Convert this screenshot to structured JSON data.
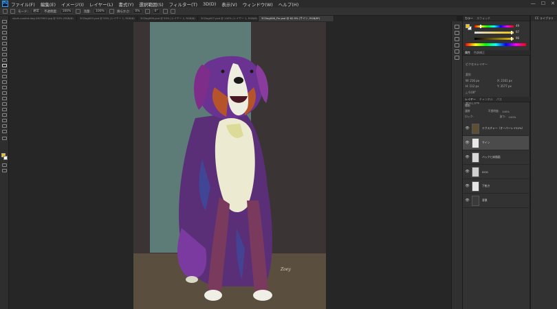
{
  "app": {
    "logo_text": "Ps"
  },
  "menu": [
    "ファイル(F)",
    "編集(E)",
    "イメージ(I)",
    "レイヤー(L)",
    "書式(Y)",
    "選択範囲(S)",
    "フィルター(T)",
    "3D(D)",
    "表示(V)",
    "ウィンドウ(W)",
    "ヘルプ(H)"
  ],
  "window_controls": [
    "—",
    "☐",
    "✕"
  ],
  "options_bar": {
    "mode_label": "モード:",
    "mode_value": "通常",
    "opacity_label": "不透明度:",
    "opacity_value": "100%",
    "flow_label": "流量:",
    "flow_value": "100%",
    "smoothing_label": "滑らかさ:",
    "smoothing_value": "0%",
    "angle_value": "0°"
  },
  "tabs": [
    {
      "label": "short-coated-dog-2623902.jpg @ 50% (RGB/8)",
      "active": false
    },
    {
      "label": "3CDog003.psd @ 50% (レイヤー 1, RGB/8)",
      "active": false
    },
    {
      "label": "3CDog006.psd @ 50% (レイヤー 2, RGB/8)",
      "active": false
    },
    {
      "label": "3CDog007.psd @ 100% (レイヤー 1, RGB/8)",
      "active": false
    },
    {
      "label": "3CDog008_Fin.psd @ 62.9% (サイン, RGB/8*)",
      "active": true
    }
  ],
  "color_panel": {
    "tabs": [
      "カラー",
      "スウォッチ"
    ],
    "h_value": "49",
    "s_value": "97",
    "b_value": "96",
    "fg_color": "#f1c40f",
    "bg_color": "#ffffff",
    "h_fill": 0.14,
    "s_fill": 0.97,
    "b_fill": 0.96
  },
  "properties_panel": {
    "tabs": [
      "属性",
      "色調補正"
    ],
    "kind": "ピクセルレイヤー",
    "section": "変形",
    "w": "W: 216 px",
    "x": "X: 2161 px",
    "h": "H: 112 px",
    "y": "Y: 3577 px",
    "angle": "△ 0.00°",
    "align_label": "整列と分布"
  },
  "layers_panel": {
    "tabs": [
      "レイヤー",
      "チャンネル",
      "パス"
    ],
    "filter_label": "種類",
    "blend_mode": "通常",
    "opacity_label": "不透明度:",
    "opacity_value": "100%",
    "lock_label": "ロック:",
    "fill_label": "塗り:",
    "fill_value": "100%",
    "layers": [
      {
        "name": "テクスチャー（オーバーレイ52%）",
        "selected": false,
        "thumb": "#5e4e33"
      },
      {
        "name": "サイン",
        "selected": true,
        "thumb": "#e8e8e8"
      },
      {
        "name": "バックと床描画",
        "selected": false,
        "thumb": "#d9d9d9"
      },
      {
        "name": "DOG",
        "selected": false,
        "thumb": "#cfcfcf"
      },
      {
        "name": "下絵き",
        "selected": false,
        "thumb": "#e4e4e4"
      },
      {
        "name": "背景",
        "selected": false,
        "thumb": "#3a3a3a"
      }
    ]
  },
  "libraries": {
    "title": "CC ライブラリ"
  },
  "canvas": {
    "board_color": "#3a3534",
    "teal_color": "#5d7c78",
    "floor_color": "#5a4e3f",
    "signature": "Zoey"
  }
}
